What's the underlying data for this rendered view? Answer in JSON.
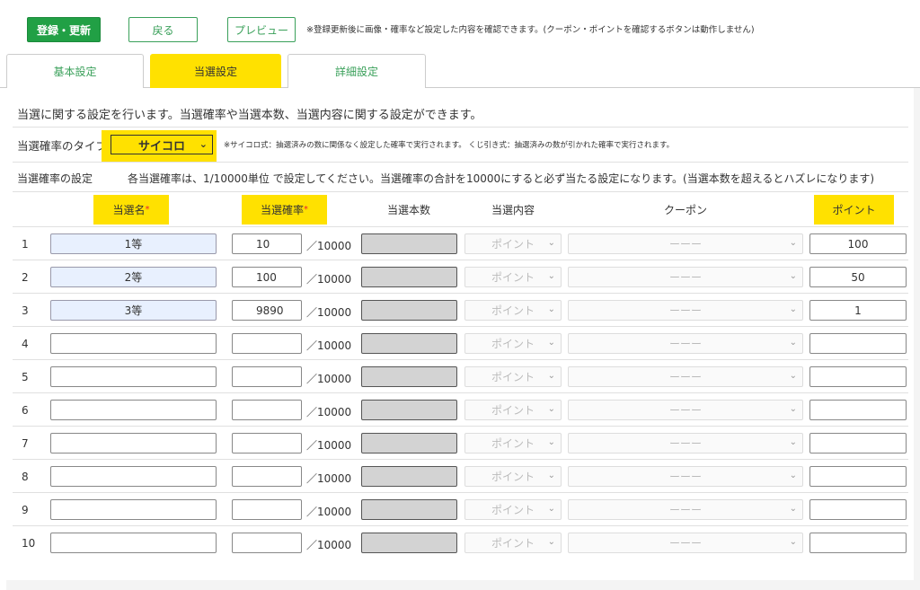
{
  "toolbar": {
    "register_label": "登録・更新",
    "back_label": "戻る",
    "preview_label": "プレビュー",
    "note": "※登録更新後に画像・確率など設定した内容を確認できます。(クーポン・ポイントを確認するボタンは動作しません)"
  },
  "tabs": [
    {
      "label": "基本設定"
    },
    {
      "label": "当選設定"
    },
    {
      "label": "詳細設定"
    }
  ],
  "intro": "当選に関する設定を行います。当選確率や当選本数、当選内容に関する設定ができます。",
  "type_setting": {
    "label": "当選確率のタイプ",
    "required_mark": "*",
    "selected": "サイコロ",
    "note": "※サイコロ式：抽選済みの数に関係なく設定した確率で実行されます。 くじ引き式：抽選済みの数が引かれた確率で実行されます。"
  },
  "rate_setting": {
    "label": "当選確率の設定",
    "note": "各当選確率は、1/10000単位 で設定してください。当選確率の合計を10000にすると必ず当たる設定になります。(当選本数を超えるとハズレになります)"
  },
  "table": {
    "headers": {
      "name": "当選名",
      "rate": "当選確率",
      "count": "当選本数",
      "content": "当選内容",
      "coupon": "クーポン",
      "point": "ポイント"
    },
    "required_mark": "*",
    "denominator": "／10000",
    "content_placeholder": "ポイント",
    "coupon_placeholder": "ーーー",
    "rows": [
      {
        "num": "1",
        "name": "1等",
        "rate": "10",
        "point": "100"
      },
      {
        "num": "2",
        "name": "2等",
        "rate": "100",
        "point": "50"
      },
      {
        "num": "3",
        "name": "3等",
        "rate": "9890",
        "point": "1"
      },
      {
        "num": "4",
        "name": "",
        "rate": "",
        "point": ""
      },
      {
        "num": "5",
        "name": "",
        "rate": "",
        "point": ""
      },
      {
        "num": "6",
        "name": "",
        "rate": "",
        "point": ""
      },
      {
        "num": "7",
        "name": "",
        "rate": "",
        "point": ""
      },
      {
        "num": "8",
        "name": "",
        "rate": "",
        "point": ""
      },
      {
        "num": "9",
        "name": "",
        "rate": "",
        "point": ""
      },
      {
        "num": "10",
        "name": "",
        "rate": "",
        "point": ""
      }
    ]
  }
}
